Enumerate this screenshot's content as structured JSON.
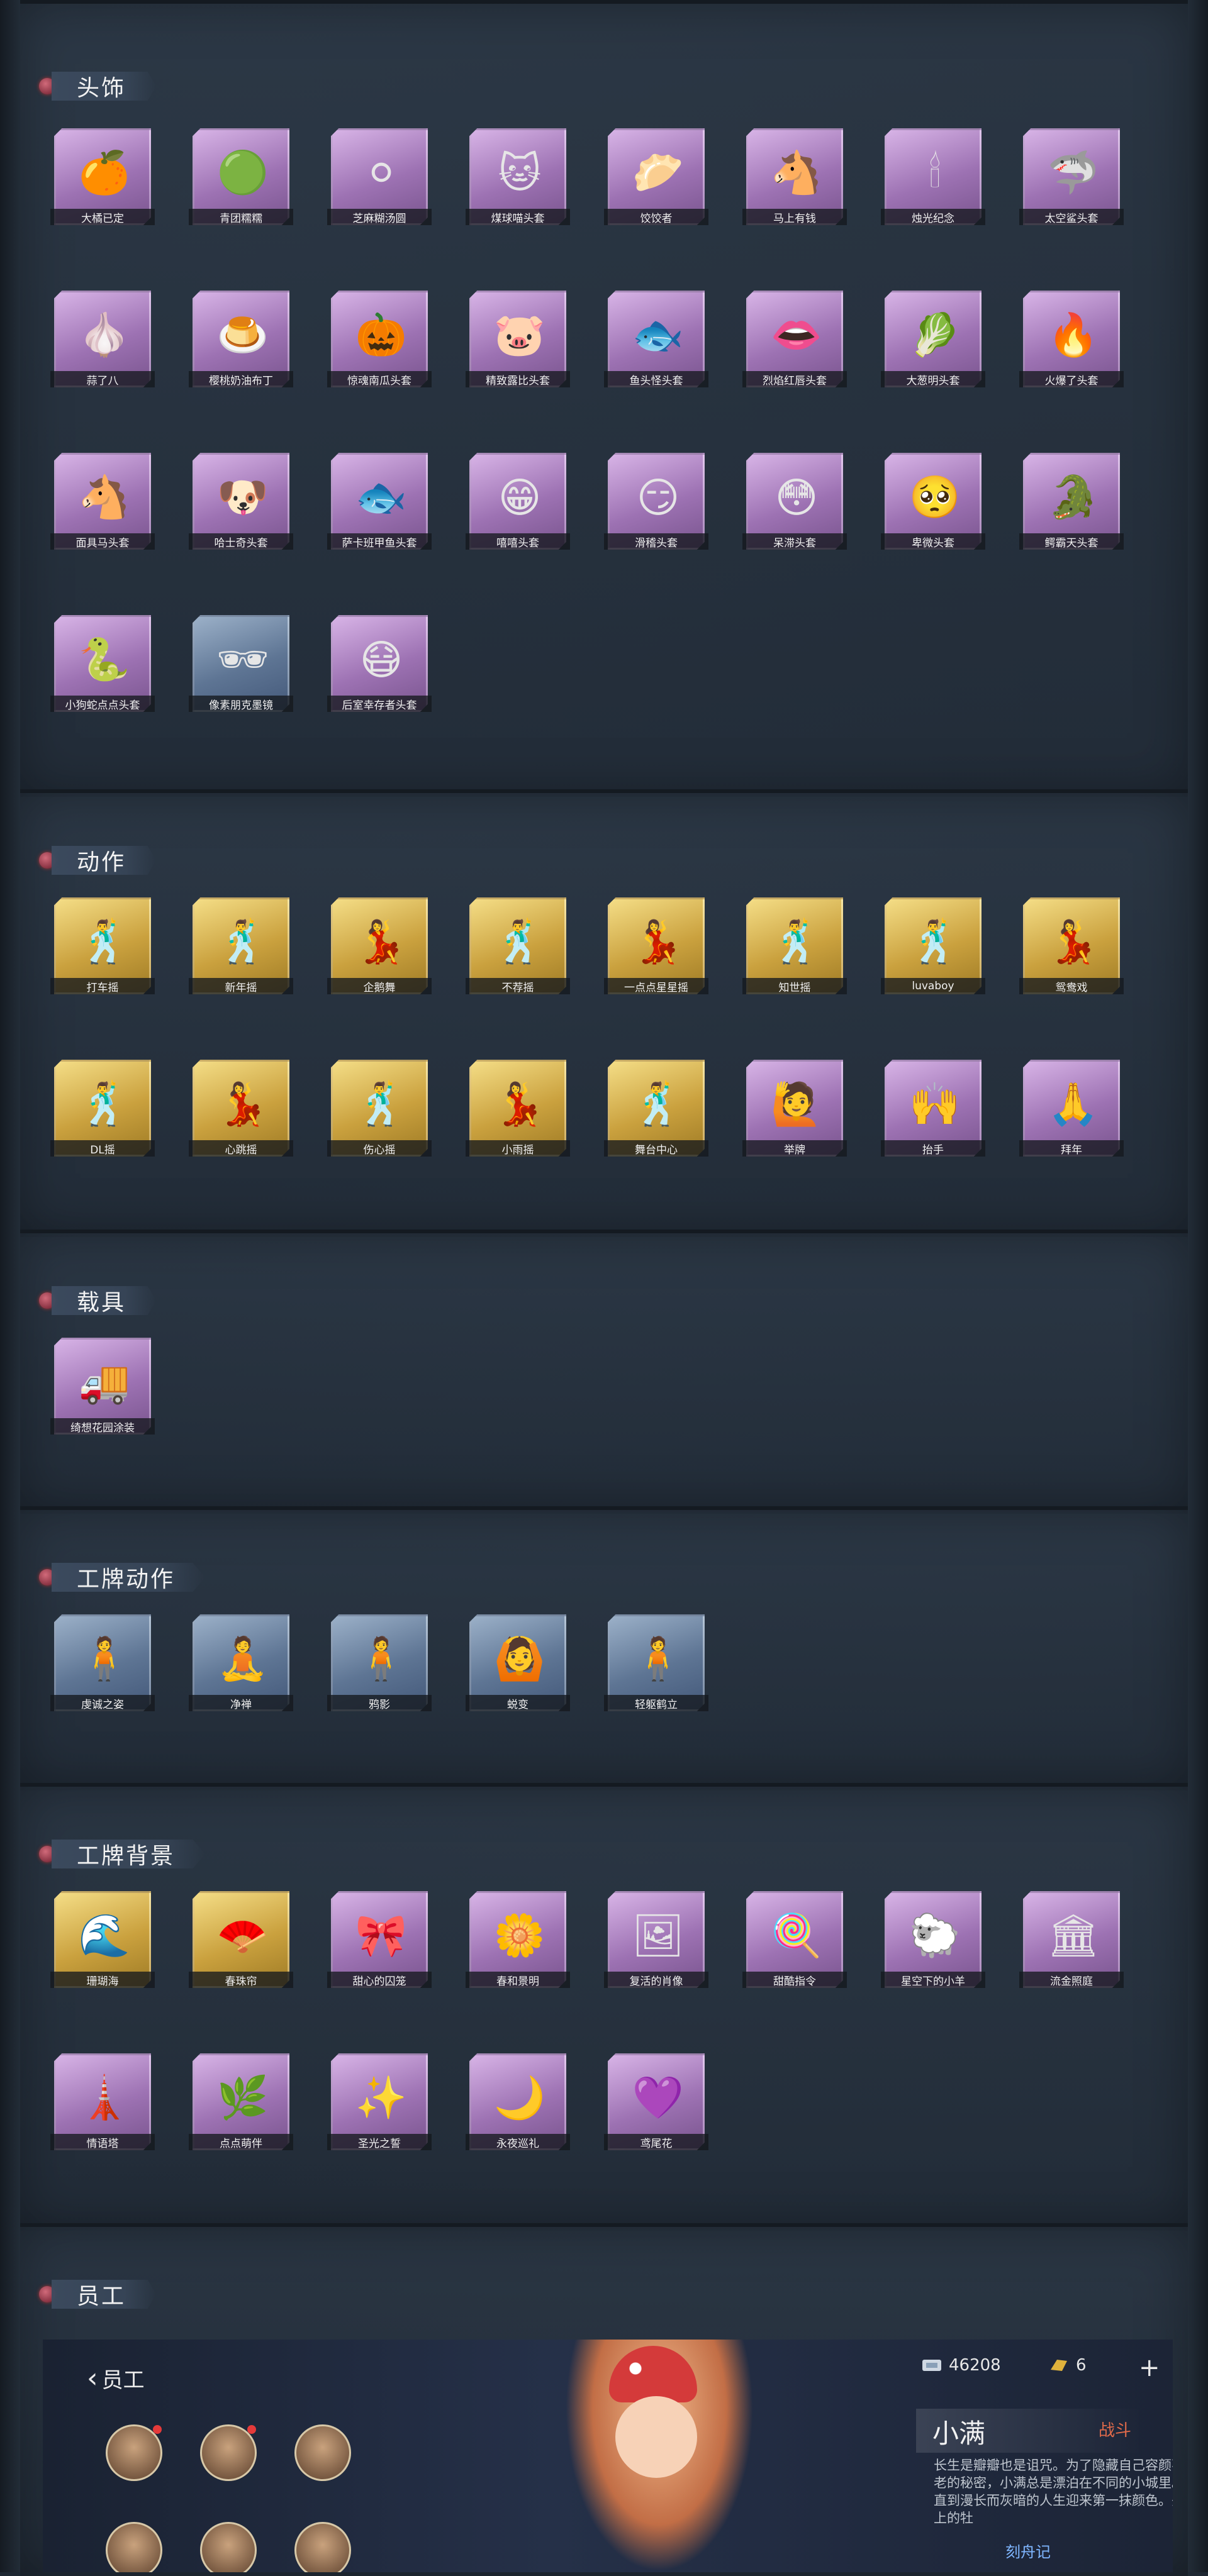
{
  "sections": {
    "headwear": {
      "title": "头饰",
      "items": [
        {
          "label": "大橘已定",
          "icon": "🍊",
          "tone": "purple"
        },
        {
          "label": "青团糯糯",
          "icon": "🟢",
          "tone": "purple"
        },
        {
          "label": "芝麻糊汤圆",
          "icon": "⚪",
          "tone": "purple"
        },
        {
          "label": "煤球喵头套",
          "icon": "🐱",
          "tone": "purple"
        },
        {
          "label": "饺饺者",
          "icon": "🥟",
          "tone": "purple"
        },
        {
          "label": "马上有钱",
          "icon": "🐴",
          "tone": "purple"
        },
        {
          "label": "烛光纪念",
          "icon": "🕯",
          "tone": "purple"
        },
        {
          "label": "太空鲨头套",
          "icon": "🦈",
          "tone": "purple"
        },
        {
          "label": "蒜了八",
          "icon": "🧄",
          "tone": "purple"
        },
        {
          "label": "樱桃奶油布丁",
          "icon": "🍮",
          "tone": "purple"
        },
        {
          "label": "惊魂南瓜头套",
          "icon": "🎃",
          "tone": "purple"
        },
        {
          "label": "精致露比头套",
          "icon": "🐷",
          "tone": "purple"
        },
        {
          "label": "鱼头怪头套",
          "icon": "🐟",
          "tone": "purple"
        },
        {
          "label": "烈焰红唇头套",
          "icon": "👄",
          "tone": "purple"
        },
        {
          "label": "大葱明头套",
          "icon": "🥬",
          "tone": "purple"
        },
        {
          "label": "火爆了头套",
          "icon": "🔥",
          "tone": "purple"
        },
        {
          "label": "面具马头套",
          "icon": "🐴",
          "tone": "purple"
        },
        {
          "label": "哈士奇头套",
          "icon": "🐶",
          "tone": "purple"
        },
        {
          "label": "萨卡班甲鱼头套",
          "icon": "🐟",
          "tone": "purple"
        },
        {
          "label": "嘻嘻头套",
          "icon": "😁",
          "tone": "purple"
        },
        {
          "label": "滑稽头套",
          "icon": "😏",
          "tone": "purple"
        },
        {
          "label": "呆滞头套",
          "icon": "😳",
          "tone": "purple"
        },
        {
          "label": "卑微头套",
          "icon": "🥺",
          "tone": "purple"
        },
        {
          "label": "鳄霸天头套",
          "icon": "🐊",
          "tone": "purple"
        },
        {
          "label": "小狗蛇点点头套",
          "icon": "🐍",
          "tone": "purple"
        },
        {
          "label": "像素朋克墨镜",
          "icon": "🕶",
          "tone": "blue"
        },
        {
          "label": "后室幸存者头套",
          "icon": "😷",
          "tone": "purple"
        }
      ]
    },
    "actions": {
      "title": "动作",
      "items": [
        {
          "label": "打车摇",
          "icon": "🕺",
          "tone": "gold"
        },
        {
          "label": "新年摇",
          "icon": "🕺",
          "tone": "gold"
        },
        {
          "label": "企鹅舞",
          "icon": "💃",
          "tone": "gold"
        },
        {
          "label": "不荐摇",
          "icon": "🕺",
          "tone": "gold"
        },
        {
          "label": "一点点星星摇",
          "icon": "💃",
          "tone": "gold"
        },
        {
          "label": "知世摇",
          "icon": "🕺",
          "tone": "gold"
        },
        {
          "label": "luvaboy",
          "icon": "🕺",
          "tone": "gold"
        },
        {
          "label": "鸳鸯戏",
          "icon": "💃",
          "tone": "gold"
        },
        {
          "label": "DL摇",
          "icon": "🕺",
          "tone": "gold"
        },
        {
          "label": "心跳摇",
          "icon": "💃",
          "tone": "gold"
        },
        {
          "label": "伤心摇",
          "icon": "🕺",
          "tone": "gold"
        },
        {
          "label": "小雨摇",
          "icon": "💃",
          "tone": "gold"
        },
        {
          "label": "舞台中心",
          "icon": "🕺",
          "tone": "gold"
        },
        {
          "label": "举牌",
          "icon": "🙋",
          "tone": "purple"
        },
        {
          "label": "抬手",
          "icon": "🙌",
          "tone": "purple"
        },
        {
          "label": "拜年",
          "icon": "🙏",
          "tone": "purple"
        }
      ]
    },
    "vehicles": {
      "title": "载具",
      "items": [
        {
          "label": "绮想花园涂装",
          "icon": "🚚",
          "tone": "purple"
        }
      ]
    },
    "badge_actions": {
      "title": "工牌动作",
      "items": [
        {
          "label": "虔诚之姿",
          "icon": "🧍",
          "tone": "blue"
        },
        {
          "label": "净禅",
          "icon": "🧘",
          "tone": "blue"
        },
        {
          "label": "鸦影",
          "icon": "🧍",
          "tone": "blue"
        },
        {
          "label": "蜕变",
          "icon": "🙆",
          "tone": "blue"
        },
        {
          "label": "轻躯鹤立",
          "icon": "🧍",
          "tone": "blue"
        }
      ]
    },
    "badge_backgrounds": {
      "title": "工牌背景",
      "items": [
        {
          "label": "珊瑚海",
          "icon": "🌊",
          "tone": "gold"
        },
        {
          "label": "春珠帘",
          "icon": "🪭",
          "tone": "gold"
        },
        {
          "label": "甜心的囚笼",
          "icon": "🎀",
          "tone": "purple"
        },
        {
          "label": "春和景明",
          "icon": "🌼",
          "tone": "purple"
        },
        {
          "label": "复活的肖像",
          "icon": "🖼",
          "tone": "purple"
        },
        {
          "label": "甜酷指令",
          "icon": "🍭",
          "tone": "purple"
        },
        {
          "label": "星空下的小羊",
          "icon": "🐑",
          "tone": "purple"
        },
        {
          "label": "流金照庭",
          "icon": "🏛",
          "tone": "purple"
        },
        {
          "label": "情语塔",
          "icon": "🗼",
          "tone": "purple"
        },
        {
          "label": "点点萌伴",
          "icon": "🌿",
          "tone": "purple"
        },
        {
          "label": "圣光之誓",
          "icon": "✨",
          "tone": "purple"
        },
        {
          "label": "永夜巡礼",
          "icon": "🌙",
          "tone": "purple"
        },
        {
          "label": "鸢尾花",
          "icon": "💜",
          "tone": "purple"
        }
      ]
    },
    "staff": {
      "title": "员工"
    }
  },
  "employee_panel": {
    "back_label": "员工",
    "currency_1": "46208",
    "currency_2": "6",
    "plus": "+",
    "name": "小满",
    "tag": "战斗",
    "description": "长生是瓣瓣也是诅咒。为了隐藏自己容颜不老的秘密，小满总是漂泊在不同的小城里。直到漫长而灰暗的人生迎来第一抹颜色。头上的牡",
    "link": "刻舟记"
  }
}
